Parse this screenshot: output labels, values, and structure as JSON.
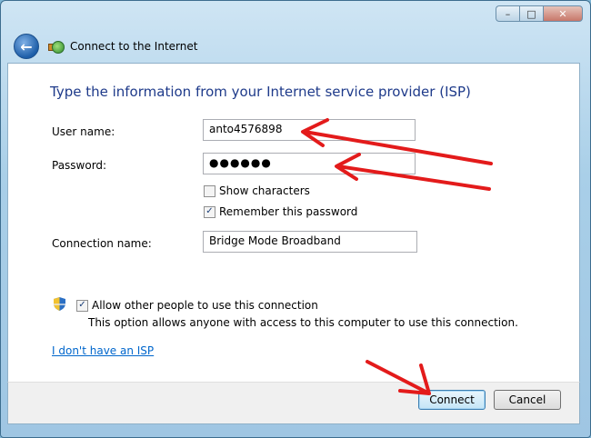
{
  "window": {
    "title": "Connect to the Internet",
    "caption": {
      "minimize": "–",
      "maximize": "□",
      "close": "✕"
    }
  },
  "content": {
    "heading": "Type the information from your Internet service provider (ISP)",
    "user_name_label": "User name:",
    "user_name_value": "anto4576898",
    "password_label": "Password:",
    "password_value": "●●●●●●",
    "show_characters_label": "Show characters",
    "remember_password_label": "Remember this password",
    "connection_name_label": "Connection name:",
    "connection_name_value": "Bridge Mode Broadband",
    "allow_others_label": "Allow other people to use this connection",
    "allow_others_desc": "This option allows anyone with access to this computer to use this connection.",
    "no_isp_link": "I don't have an ISP"
  },
  "footer": {
    "connect_label": "Connect",
    "cancel_label": "Cancel"
  },
  "annotations": {
    "arrow_color": "#e31b1b"
  }
}
